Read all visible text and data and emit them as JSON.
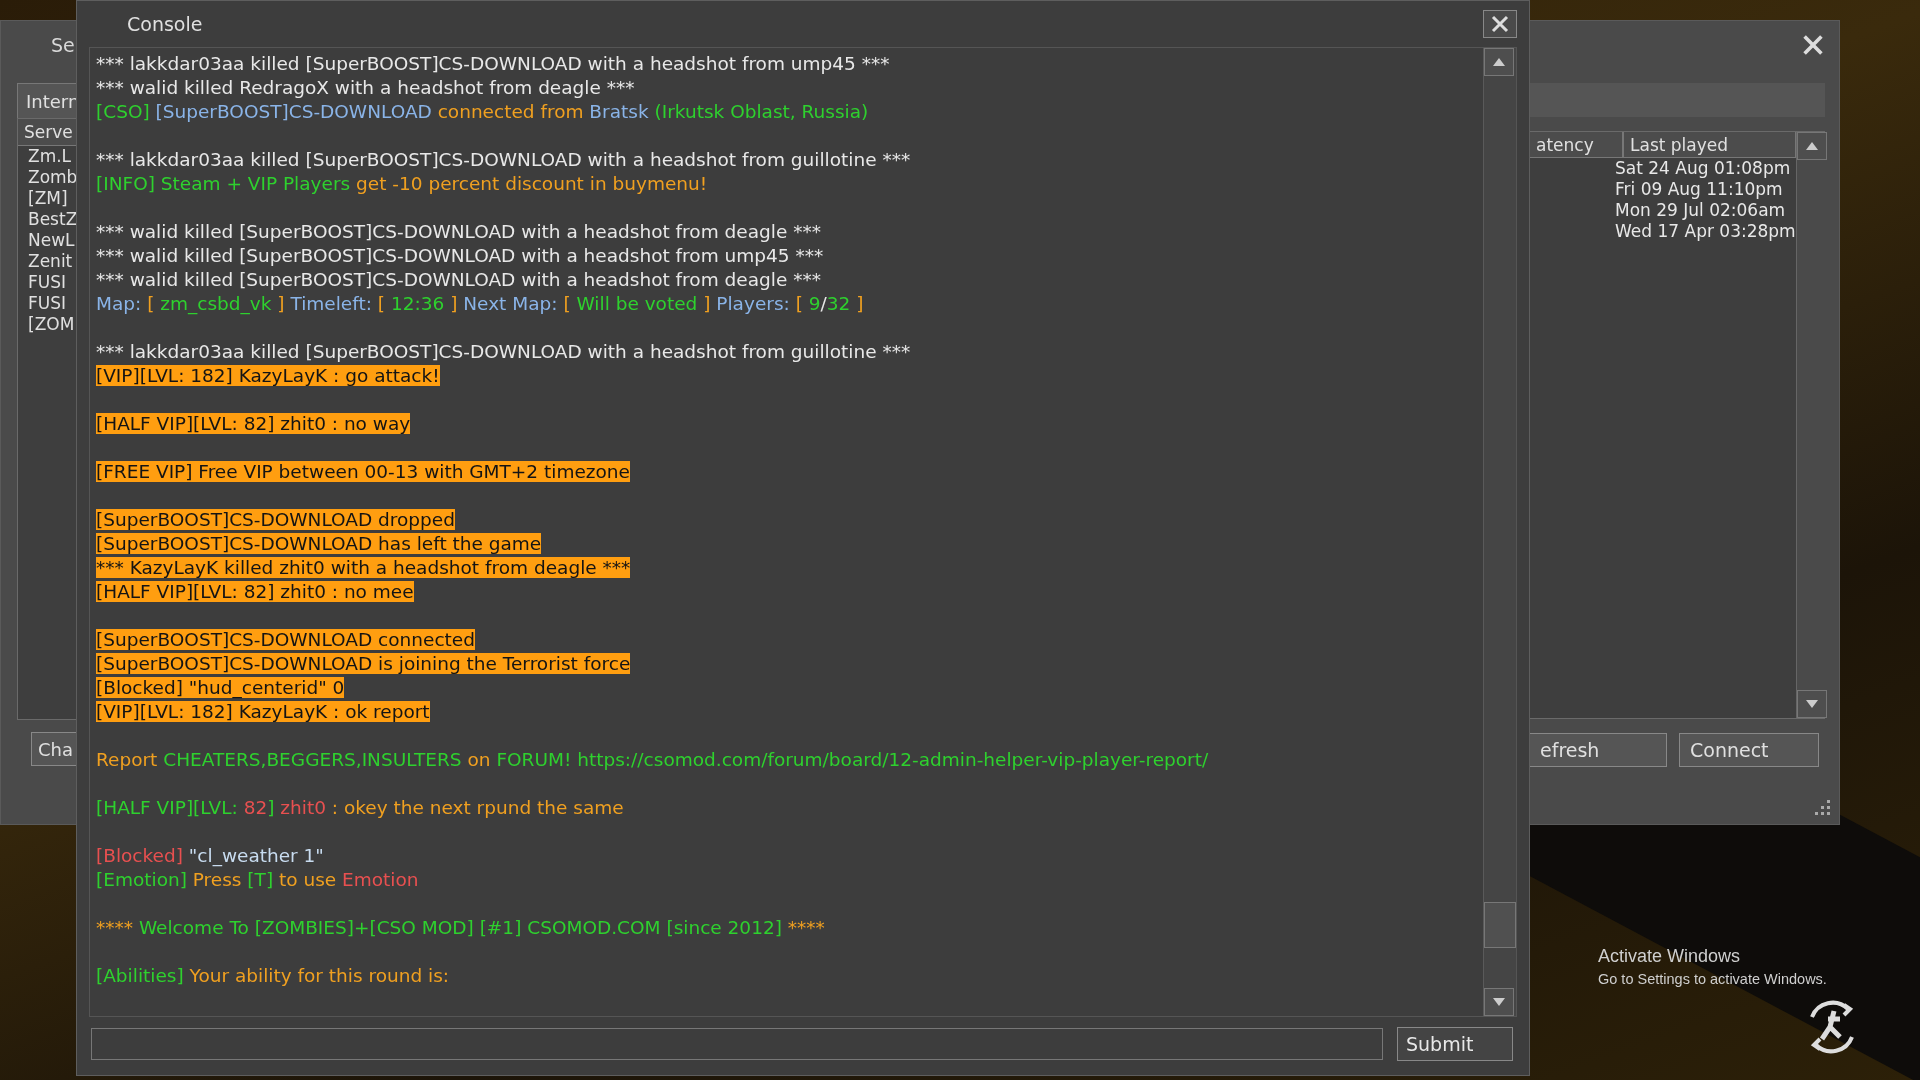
{
  "servers_window": {
    "title": "Se",
    "tab": "Intern",
    "list_header": "Serve",
    "rows": [
      "Zm.L",
      "Zomb",
      "[ZM]",
      "BestZ",
      "NewL",
      "Zenit",
      "FUSI",
      "FUSI",
      "[ZOM"
    ],
    "left_button": "Cha",
    "columns": [
      "atency",
      "Last played"
    ],
    "last_played": [
      "Sat 24 Aug 01:08pm",
      "Fri 09 Aug 11:10pm",
      "Mon 29 Jul 02:06am",
      "Wed 17 Apr 03:28pm"
    ],
    "buttons": [
      "efresh",
      "Connect"
    ]
  },
  "console": {
    "title": "Console",
    "submit": "Submit",
    "blocks": [
      [
        {
          "highlighted": false,
          "segments": [
            {
              "text": "*** lakkdar03aa killed [SuperBOOST]CS-DOWNLOAD with a headshot from ump45 ***",
              "color": "#e8e8e8"
            }
          ]
        },
        {
          "highlighted": false,
          "segments": [
            {
              "text": "*** walid killed RedragoX with a headshot from deagle ***",
              "color": "#e8e8e8"
            }
          ]
        },
        {
          "highlighted": false,
          "segments": [
            {
              "text": "[CSO]",
              "color": "#2ed12e"
            },
            {
              "text": " [SuperBOOST]CS-DOWNLOAD",
              "color": "#8ab4e8"
            },
            {
              "text": " connected from ",
              "color": "#f0a020"
            },
            {
              "text": "Bratsk",
              "color": "#8ab4e8"
            },
            {
              "text": " (Irkutsk Oblast, Russia)",
              "color": "#2ed12e"
            }
          ]
        }
      ],
      [
        {
          "highlighted": false,
          "segments": [
            {
              "text": "*** lakkdar03aa killed [SuperBOOST]CS-DOWNLOAD with a headshot from guillotine ***",
              "color": "#e8e8e8"
            }
          ]
        },
        {
          "highlighted": false,
          "segments": [
            {
              "text": "[INFO] Steam + VIP Players",
              "color": "#2ed12e"
            },
            {
              "text": " get -10 percent discount in buymenu!",
              "color": "#f0a020"
            }
          ]
        }
      ],
      [
        {
          "highlighted": false,
          "segments": [
            {
              "text": "*** walid killed [SuperBOOST]CS-DOWNLOAD with a headshot from deagle ***",
              "color": "#e8e8e8"
            }
          ]
        },
        {
          "highlighted": false,
          "segments": [
            {
              "text": "*** walid killed [SuperBOOST]CS-DOWNLOAD with a headshot from ump45 ***",
              "color": "#e8e8e8"
            }
          ]
        },
        {
          "highlighted": false,
          "segments": [
            {
              "text": "*** walid killed [SuperBOOST]CS-DOWNLOAD with a headshot from deagle ***",
              "color": "#e8e8e8"
            }
          ]
        },
        {
          "highlighted": false,
          "segments": [
            {
              "text": "Map: ",
              "color": "#8ab4e8"
            },
            {
              "text": "[ ",
              "color": "#f0a020"
            },
            {
              "text": "zm_csbd_vk",
              "color": "#2ed12e"
            },
            {
              "text": " ]",
              "color": "#f0a020"
            },
            {
              "text": " Timeleft: ",
              "color": "#8ab4e8"
            },
            {
              "text": "[ ",
              "color": "#f0a020"
            },
            {
              "text": "12:36",
              "color": "#2ed12e"
            },
            {
              "text": " ]",
              "color": "#f0a020"
            },
            {
              "text": " Next Map: ",
              "color": "#8ab4e8"
            },
            {
              "text": "[ ",
              "color": "#f0a020"
            },
            {
              "text": "Will be voted",
              "color": "#2ed12e"
            },
            {
              "text": " ]",
              "color": "#f0a020"
            },
            {
              "text": " Players: ",
              "color": "#8ab4e8"
            },
            {
              "text": "[ ",
              "color": "#f0a020"
            },
            {
              "text": "9",
              "color": "#2ed12e"
            },
            {
              "text": "/",
              "color": "#e8e8e8"
            },
            {
              "text": "32",
              "color": "#2ed12e"
            },
            {
              "text": " ]",
              "color": "#f0a020"
            }
          ]
        }
      ],
      [
        {
          "highlighted": false,
          "segments": [
            {
              "text": "*** lakkdar03aa killed [SuperBOOST]CS-DOWNLOAD with a headshot from guillotine ***",
              "color": "#e8e8e8"
            }
          ]
        },
        {
          "highlighted": true,
          "segments": [
            {
              "text": "[VIP][LVL: 182] KazyLayK : go attack!"
            }
          ]
        }
      ],
      [
        {
          "highlighted": true,
          "segments": [
            {
              "text": "[HALF VIP][LVL: 82] zhit0 : no way"
            }
          ]
        }
      ],
      [
        {
          "highlighted": true,
          "segments": [
            {
              "text": "[FREE VIP] Free VIP between 00-13 with GMT+2 timezone"
            }
          ]
        }
      ],
      [
        {
          "highlighted": true,
          "segments": [
            {
              "text": "[SuperBOOST]CS-DOWNLOAD dropped"
            }
          ]
        },
        {
          "highlighted": true,
          "segments": [
            {
              "text": "[SuperBOOST]CS-DOWNLOAD has left the game"
            }
          ]
        },
        {
          "highlighted": true,
          "segments": [
            {
              "text": "*** KazyLayK killed zhit0 with a headshot from deagle ***"
            }
          ]
        },
        {
          "highlighted": true,
          "segments": [
            {
              "text": "[HALF VIP][LVL: 82] zhit0 : no mee"
            }
          ]
        }
      ],
      [
        {
          "highlighted": true,
          "segments": [
            {
              "text": "[SuperBOOST]CS-DOWNLOAD connected"
            }
          ]
        },
        {
          "highlighted": true,
          "segments": [
            {
              "text": "[SuperBOOST]CS-DOWNLOAD is joining the Terrorist force"
            }
          ]
        },
        {
          "highlighted": true,
          "segments": [
            {
              "text": "[Blocked] \"hud_centerid\" 0"
            }
          ]
        },
        {
          "highlighted": true,
          "segments": [
            {
              "text": "[VIP][LVL: 182] KazyLayK : ok report"
            }
          ]
        }
      ],
      [
        {
          "highlighted": false,
          "segments": [
            {
              "text": "Report ",
              "color": "#f0a020"
            },
            {
              "text": "CHEATERS,BEGGERS,INSULTERS",
              "color": "#2ed12e"
            },
            {
              "text": " on ",
              "color": "#f0a020"
            },
            {
              "text": "FORUM!",
              "color": "#2ed12e"
            },
            {
              "text": " https://csomod.com/forum/board/12-admin-helper-vip-player-report/",
              "color": "#2ed12e"
            }
          ]
        }
      ],
      [
        {
          "highlighted": false,
          "segments": [
            {
              "text": "[HALF VIP][LVL: ",
              "color": "#2ed12e"
            },
            {
              "text": "82",
              "color": "#e85050"
            },
            {
              "text": "] ",
              "color": "#2ed12e"
            },
            {
              "text": "zhit0",
              "color": "#e85050"
            },
            {
              "text": " : okey the next rpund the same",
              "color": "#f0a020"
            }
          ]
        }
      ],
      [
        {
          "highlighted": false,
          "segments": [
            {
              "text": "[Blocked]",
              "color": "#e85050"
            },
            {
              "text": " \"cl_weather 1\"",
              "color": "#c8dcf0"
            }
          ]
        },
        {
          "highlighted": false,
          "segments": [
            {
              "text": "[Emotion]",
              "color": "#2ed12e"
            },
            {
              "text": " Press ",
              "color": "#f0a020"
            },
            {
              "text": "[T]",
              "color": "#2ed12e"
            },
            {
              "text": " to use ",
              "color": "#f0a020"
            },
            {
              "text": "Emotion",
              "color": "#e85050"
            }
          ]
        }
      ],
      [
        {
          "highlighted": false,
          "segments": [
            {
              "text": "**** ",
              "color": "#f0a020"
            },
            {
              "text": "Welcome To [ZOMBIES]+[CSO MOD] [#1] CSOMOD.COM [since 2012]",
              "color": "#2ed12e"
            },
            {
              "text": " ****",
              "color": "#f0a020"
            }
          ]
        }
      ],
      [
        {
          "highlighted": false,
          "segments": [
            {
              "text": "[Abilities]",
              "color": "#2ed12e"
            },
            {
              "text": " Your ability for this round is:",
              "color": "#f0a020"
            }
          ]
        }
      ]
    ]
  },
  "activation_notice": {
    "title": "Activate Windows",
    "subtitle": "Go to Settings to activate Windows."
  }
}
